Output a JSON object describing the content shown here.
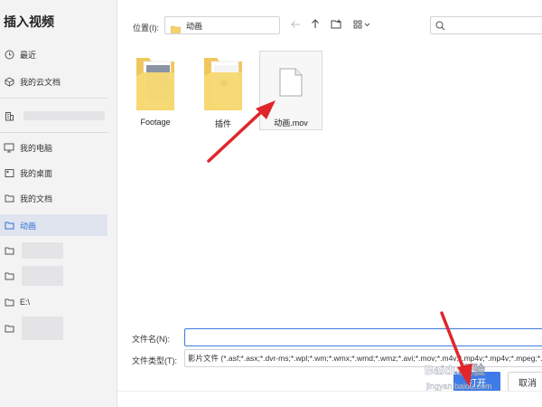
{
  "dialog": {
    "title": "插入视频"
  },
  "sidebar": {
    "items": [
      {
        "label": "最近",
        "icon": "clock-icon"
      },
      {
        "label": "我的云文档",
        "icon": "cloud-doc-icon"
      },
      {
        "label": "",
        "icon": "building-icon"
      },
      {
        "label": "我的电脑",
        "icon": "computer-icon"
      },
      {
        "label": "我的桌面",
        "icon": "desktop-icon"
      },
      {
        "label": "我的文档",
        "icon": "folder-icon"
      },
      {
        "label": "动画",
        "icon": "folder-icon",
        "active": true
      },
      {
        "label": "",
        "icon": "folder-icon"
      },
      {
        "label": "",
        "icon": "folder-icon"
      },
      {
        "label": "E:\\",
        "icon": "folder-icon"
      },
      {
        "label": "",
        "icon": "folder-icon"
      }
    ]
  },
  "toolbar": {
    "location_label": "位置(I):",
    "location_value": "动画"
  },
  "files": [
    {
      "name": "Footage",
      "type": "folder"
    },
    {
      "name": "插件",
      "type": "folder"
    },
    {
      "name": "动画.mov",
      "type": "file",
      "selected": true
    }
  ],
  "form": {
    "filename_label": "文件名(N):",
    "filename_value": "",
    "filetype_label": "文件类型(T):",
    "filetype_value": "影片文件 (*.asf;*.asx;*.dvr-ms;*.wpl;*.wm;*.wmx;*.wmd;*.wmz;*.avi;*.mov;*.m4v;*.mp4v;*.mp4v;*.mpeg;*.",
    "open_label": "打开",
    "cancel_label": "取消"
  },
  "watermark": {
    "brand": "Baidu经验",
    "url": "jingyan.baidu.com"
  },
  "colors": {
    "accent": "#3f7be6",
    "arrow": "#e0262b",
    "folder": "#f5d26b"
  }
}
